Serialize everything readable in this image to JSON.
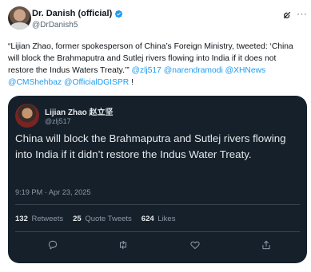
{
  "author": {
    "display_name": "Dr. Danish (official)",
    "handle": "@DrDanish5"
  },
  "icons": {
    "verified": "verified-badge-icon",
    "grok": "grok-icon",
    "more": "more-options-icon",
    "reply": "reply-icon",
    "retweet": "retweet-icon",
    "like": "like-icon",
    "share": "share-icon"
  },
  "more_glyph": "···",
  "colors": {
    "link": "#1d9bf0",
    "verified": "#1d9bf0",
    "quote_bg": "#15202b"
  },
  "post": {
    "text": "“Lijian Zhao, former spokesperson of China’s Foreign Ministry, tweeted: ‘China will block the Brahmaputra and Sutlej rivers flowing into India if it does not restore the Indus Waters Treaty.’”",
    "mentions": [
      "@zlj517",
      "@narendramodi",
      "@XHNews",
      "@CMShehbaz",
      "@OfficialDGISPR"
    ],
    "trailing": " !"
  },
  "quoted": {
    "display_name": "Lijian Zhao 赵立坚",
    "handle": "@zlj517",
    "text": "China will block the Brahmaputra and Sutlej rivers flowing into India if it didn’t restore the Indus Water Treaty.",
    "timestamp": "9:19 PM · Apr 23, 2025",
    "stats": {
      "retweets_count": "132",
      "retweets_label": "Retweets",
      "quotes_count": "25",
      "quotes_label": "Quote Tweets",
      "likes_count": "624",
      "likes_label": "Likes"
    }
  }
}
